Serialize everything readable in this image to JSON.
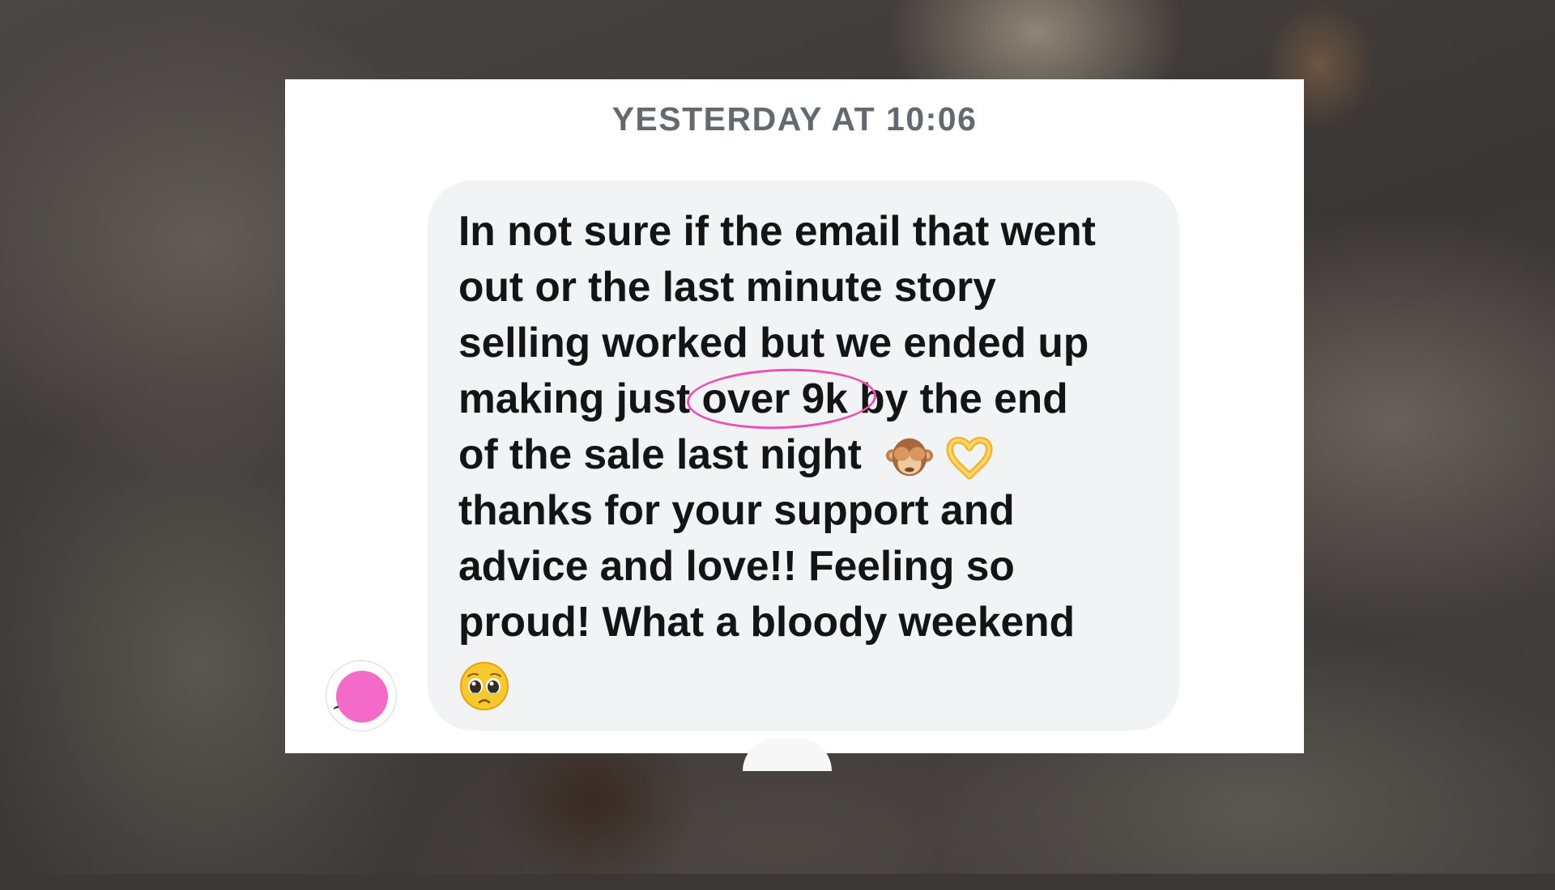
{
  "timestamp": "YESTERDAY AT 10:06",
  "message": {
    "line1": "In not sure if the email that went",
    "line2": "out or the last minute story",
    "line3": "selling worked but we ended up",
    "line4_before": "making just ",
    "line4_highlight": "over 9k",
    "line4_after": " by the end",
    "line5": "of the sale last night",
    "line6": "thanks for your support and",
    "line7": "advice and love!! Feeling so",
    "line8": "proud! What a bloody weekend"
  },
  "emojis": [
    "see-no-evil-monkey",
    "heart-hands",
    "pleading-face"
  ],
  "colors": {
    "bubble": "#f2f3f5",
    "highlight_circle": "#ee4fb6",
    "avatar_blob": "#f46ac8",
    "timestamp": "#646970"
  }
}
